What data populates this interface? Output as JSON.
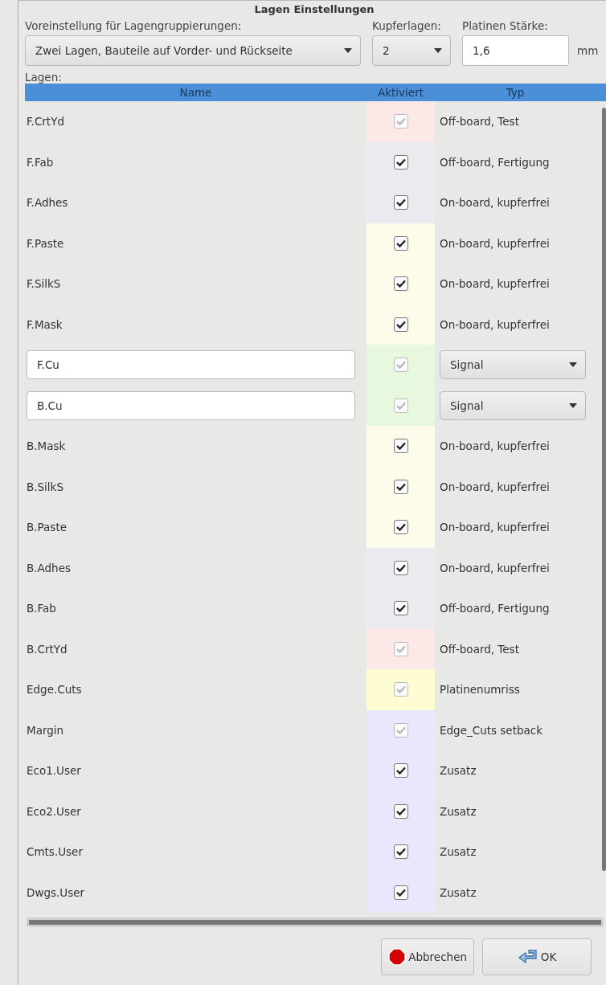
{
  "window": {
    "title": "Lagen Einstellungen"
  },
  "preset": {
    "label": "Voreinstellung für Lagengruppierungen:",
    "value": "Zwei Lagen, Bauteile auf Vorder- und Rückseite"
  },
  "copper_layers": {
    "label": "Kupferlagen:",
    "value": "2"
  },
  "thickness": {
    "label": "Platinen Stärke:",
    "value": "1,6",
    "unit": "mm"
  },
  "layers_label": "Lagen:",
  "table": {
    "columns": [
      "Name",
      "Aktiviert",
      "Typ"
    ],
    "rows": [
      {
        "kind": "text",
        "name": "F.CrtYd",
        "checked": true,
        "disabled": true,
        "color": "#fde8e8",
        "type": "Off-board, Test"
      },
      {
        "kind": "text",
        "name": "F.Fab",
        "checked": true,
        "disabled": false,
        "color": "#ebebef",
        "type": "Off-board, Fertigung"
      },
      {
        "kind": "text",
        "name": "F.Adhes",
        "checked": true,
        "disabled": false,
        "color": "#ebebef",
        "type": "On-board, kupferfrei"
      },
      {
        "kind": "text",
        "name": "F.Paste",
        "checked": true,
        "disabled": false,
        "color": "#fdfcea",
        "type": "On-board, kupferfrei"
      },
      {
        "kind": "text",
        "name": "F.SilkS",
        "checked": true,
        "disabled": false,
        "color": "#fdfcea",
        "type": "On-board, kupferfrei"
      },
      {
        "kind": "text",
        "name": "F.Mask",
        "checked": true,
        "disabled": false,
        "color": "#fdfcea",
        "type": "On-board, kupferfrei"
      },
      {
        "kind": "copper",
        "name": "F.Cu",
        "checked": true,
        "disabled": true,
        "color": "#e8f8de",
        "type": "Signal"
      },
      {
        "kind": "copper",
        "name": "B.Cu",
        "checked": true,
        "disabled": true,
        "color": "#e8f8de",
        "type": "Signal"
      },
      {
        "kind": "text",
        "name": "B.Mask",
        "checked": true,
        "disabled": false,
        "color": "#fdfcea",
        "type": "On-board, kupferfrei"
      },
      {
        "kind": "text",
        "name": "B.SilkS",
        "checked": true,
        "disabled": false,
        "color": "#fdfcea",
        "type": "On-board, kupferfrei"
      },
      {
        "kind": "text",
        "name": "B.Paste",
        "checked": true,
        "disabled": false,
        "color": "#fdfcea",
        "type": "On-board, kupferfrei"
      },
      {
        "kind": "text",
        "name": "B.Adhes",
        "checked": true,
        "disabled": false,
        "color": "#ebebef",
        "type": "On-board, kupferfrei"
      },
      {
        "kind": "text",
        "name": "B.Fab",
        "checked": true,
        "disabled": false,
        "color": "#ebebef",
        "type": "Off-board, Fertigung"
      },
      {
        "kind": "text",
        "name": "B.CrtYd",
        "checked": true,
        "disabled": true,
        "color": "#fde8e8",
        "type": "Off-board, Test"
      },
      {
        "kind": "text",
        "name": "Edge.Cuts",
        "checked": true,
        "disabled": true,
        "color": "#fdfcd2",
        "type": "Platinenumriss"
      },
      {
        "kind": "text",
        "name": "Margin",
        "checked": true,
        "disabled": true,
        "color": "#e9e7fb",
        "type": "Edge_Cuts setback"
      },
      {
        "kind": "text",
        "name": "Eco1.User",
        "checked": true,
        "disabled": false,
        "color": "#e9e7fb",
        "type": "Zusatz"
      },
      {
        "kind": "text",
        "name": "Eco2.User",
        "checked": true,
        "disabled": false,
        "color": "#e9e7fb",
        "type": "Zusatz"
      },
      {
        "kind": "text",
        "name": "Cmts.User",
        "checked": true,
        "disabled": false,
        "color": "#e9e7fb",
        "type": "Zusatz"
      },
      {
        "kind": "text",
        "name": "Dwgs.User",
        "checked": true,
        "disabled": false,
        "color": "#e9e7fb",
        "type": "Zusatz"
      }
    ]
  },
  "buttons": [
    {
      "kind": "cancel",
      "label": "Abbrechen"
    },
    {
      "kind": "ok",
      "label": "OK"
    }
  ]
}
